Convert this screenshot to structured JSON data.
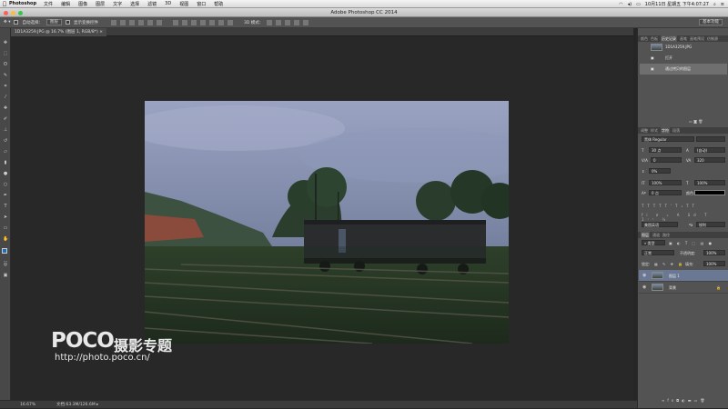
{
  "menubar": {
    "apple": "",
    "app_name": "Photoshop",
    "items": [
      "文件",
      "编辑",
      "图像",
      "图层",
      "文字",
      "选择",
      "滤镜",
      "3D",
      "视图",
      "窗口",
      "帮助"
    ],
    "clock": "10月11日 星期五 下午4:07:27"
  },
  "window": {
    "title": "Adobe Photoshop CC 2014"
  },
  "options": {
    "auto_select_label": "自动选择：",
    "auto_select_value": "图层",
    "show_transform_label": "显示变换控件",
    "mode_3d_label": "3D 模式：",
    "workspace": "基本功能"
  },
  "document": {
    "tab_label": "1D1A3259.JPG @ 16.7% (图层 1, RGB/8*) ×",
    "zoom": "16.67%",
    "doc_size": "文档:63.3M/126.6M"
  },
  "history_panel": {
    "tabs": [
      "颜色",
      "色板",
      "历史记录",
      "画笔",
      "画笔预设",
      "复制源",
      "仿制源"
    ],
    "active_tab": "历史记录",
    "snapshot": "1D1A3259.JPG",
    "items": [
      "打开",
      "通过拷贝的图层"
    ]
  },
  "character_panel": {
    "tabs": [
      "调整",
      "样式",
      "字符",
      "段落"
    ],
    "active_tab": "字符",
    "font_family": "黑体",
    "font_style": "Regular",
    "size": "30 点",
    "leading": "(自动)",
    "kerning": "0",
    "tracking": "320",
    "vscale_shift": "0%",
    "vscale": "100%",
    "hscale": "100%",
    "baseline": "0 点",
    "color_label": "颜色:",
    "language": "美国英语",
    "antialias": "锐利"
  },
  "layers_panel": {
    "tabs": [
      "图层",
      "通道",
      "路径"
    ],
    "active_tab": "图层",
    "filter_kind": "类型",
    "blend_mode": "正常",
    "opacity_label": "不透明度:",
    "opacity": "100%",
    "lock_label": "锁定:",
    "fill_label": "填充:",
    "fill": "100%",
    "layers": [
      {
        "name": "图层 1",
        "selected": true
      },
      {
        "name": "背景",
        "selected": false,
        "locked": true
      }
    ]
  },
  "watermark": {
    "brand": "POCO",
    "title": "摄影专题",
    "url": "http://photo.poco.cn/"
  },
  "colors": {
    "foreground": "#1e6fb4",
    "background": "#ffffff",
    "text_color_swatch": "#000000"
  }
}
